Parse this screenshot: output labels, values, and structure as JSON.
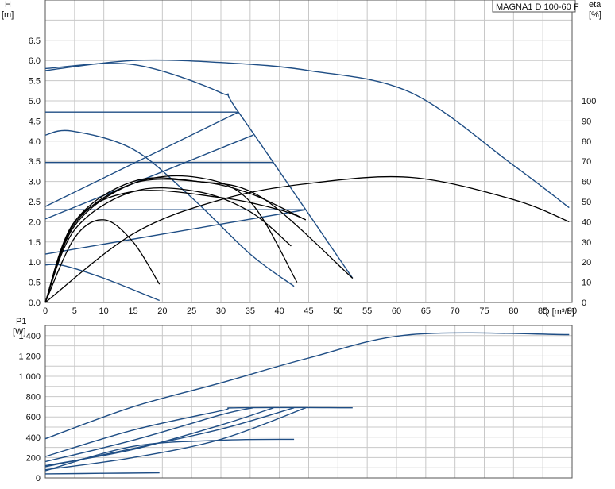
{
  "chart_data": [
    {
      "type": "line",
      "title": "MAGNA1 D 100-60 F",
      "xlabel": "Q [m³/h]",
      "ylabel": "H",
      "ylabel_unit": "[m]",
      "y2label": "eta",
      "y2label_unit": "[%]",
      "xlim": [
        0,
        90
      ],
      "ylim": [
        0,
        7.5
      ],
      "y2lim": [
        0,
        150
      ],
      "x_ticks": [
        "0",
        "5",
        "10",
        "15",
        "20",
        "25",
        "30",
        "35",
        "40",
        "45",
        "50",
        "55",
        "60",
        "65",
        "70",
        "75",
        "80",
        "85",
        "90"
      ],
      "y_ticks": [
        "0.0",
        "0.5",
        "1.0",
        "1.5",
        "2.0",
        "2.5",
        "3.0",
        "3.5",
        "4.0",
        "4.5",
        "5.0",
        "5.5",
        "6.0",
        "6.5"
      ],
      "y2_ticks": [
        "0",
        "10",
        "20",
        "30",
        "40",
        "50",
        "60",
        "70",
        "80",
        "90",
        "100"
      ],
      "grid": true,
      "colors": {
        "curve": "#1f4e85",
        "eta": "#000000",
        "grid": "#c8c8c8"
      },
      "series": [
        {
          "axis": "H",
          "x": [
            0,
            15,
            30,
            33,
            52.5
          ],
          "y": [
            5.8,
            5.9,
            5.2,
            4.72,
            0.6
          ]
        },
        {
          "axis": "H",
          "x": [
            0,
            15,
            30,
            45,
            62.5,
            80,
            89.5
          ],
          "y": [
            5.75,
            6.0,
            5.95,
            5.75,
            5.2,
            3.4,
            2.35
          ]
        },
        {
          "axis": "H",
          "x": [
            0,
            4.5,
            15,
            25,
            35,
            42.5
          ],
          "y": [
            4.15,
            4.25,
            3.8,
            2.6,
            1.2,
            0.4
          ]
        },
        {
          "axis": "H",
          "x": [
            0,
            33
          ],
          "y": [
            4.72,
            4.72
          ]
        },
        {
          "axis": "H",
          "x": [
            0,
            39
          ],
          "y": [
            3.47,
            3.47
          ]
        },
        {
          "axis": "H",
          "x": [
            0,
            44.5
          ],
          "y": [
            2.3,
            2.3
          ]
        },
        {
          "axis": "H",
          "x": [
            0,
            3,
            10,
            19.5
          ],
          "y": [
            0.93,
            0.92,
            0.6,
            0.05
          ]
        },
        {
          "axis": "H",
          "x": [
            0,
            33
          ],
          "y": [
            2.38,
            4.72
          ]
        },
        {
          "axis": "H",
          "x": [
            0,
            35.5
          ],
          "y": [
            2.07,
            4.15
          ]
        },
        {
          "axis": "H",
          "x": [
            0,
            44.5
          ],
          "y": [
            1.2,
            2.3
          ]
        },
        {
          "axis": "eta",
          "x": [
            0,
            15,
            30,
            45,
            62.5,
            80,
            89.5
          ],
          "y": [
            0,
            34,
            51,
            59,
            62,
            51,
            40
          ]
        },
        {
          "axis": "eta",
          "x": [
            0,
            5,
            10,
            15,
            19.5
          ],
          "y": [
            0,
            32,
            41,
            30,
            9
          ]
        },
        {
          "axis": "eta",
          "x": [
            0,
            5,
            15,
            26,
            35,
            43
          ],
          "y": [
            0,
            38,
            59,
            62,
            50,
            10
          ]
        },
        {
          "axis": "eta",
          "x": [
            0,
            5,
            15,
            26,
            37,
            52.5
          ],
          "y": [
            0,
            40,
            60,
            60,
            52,
            12
          ]
        },
        {
          "axis": "eta",
          "x": [
            0,
            5,
            15,
            26,
            35,
            44.5
          ],
          "y": [
            0,
            39,
            59,
            60,
            54,
            41
          ]
        },
        {
          "axis": "eta",
          "x": [
            0,
            5,
            15,
            30,
            40,
            44.5
          ],
          "y": [
            0,
            40,
            55,
            52,
            46,
            41
          ]
        },
        {
          "axis": "eta",
          "x": [
            0,
            5,
            15,
            26,
            35,
            42
          ],
          "y": [
            0,
            36,
            55,
            55,
            45,
            28
          ]
        }
      ]
    },
    {
      "type": "line",
      "xlabel": "",
      "ylabel": "P1",
      "ylabel_unit": "[W]",
      "xlim": [
        0,
        90
      ],
      "ylim": [
        0,
        1500
      ],
      "y_ticks": [
        "0",
        "200",
        "400",
        "600",
        "800",
        "1 000",
        "1 200",
        "1 400"
      ],
      "grid": true,
      "colors": {
        "curve": "#1f4e85",
        "grid": "#c8c8c8"
      },
      "series": [
        {
          "x": [
            0,
            15,
            30,
            45,
            62.5,
            89.5
          ],
          "y": [
            385,
            700,
            935,
            1180,
            1410,
            1410
          ]
        },
        {
          "x": [
            0,
            15,
            30,
            33,
            52.5
          ],
          "y": [
            210,
            470,
            660,
            690,
            690
          ]
        },
        {
          "x": [
            0,
            15,
            30,
            35.5
          ],
          "y": [
            160,
            370,
            620,
            690
          ]
        },
        {
          "x": [
            0,
            15,
            30,
            39
          ],
          "y": [
            120,
            280,
            520,
            690
          ]
        },
        {
          "x": [
            0,
            15,
            30,
            44.5
          ],
          "y": [
            80,
            200,
            380,
            690
          ]
        },
        {
          "x": [
            0,
            15,
            30,
            42.5
          ],
          "y": [
            70,
            310,
            370,
            380
          ]
        },
        {
          "x": [
            0,
            10,
            19.5
          ],
          "y": [
            40,
            45,
            50
          ]
        },
        {
          "x": [
            0,
            15,
            30,
            42.5
          ],
          "y": [
            110,
            290,
            480,
            690
          ]
        }
      ]
    }
  ]
}
